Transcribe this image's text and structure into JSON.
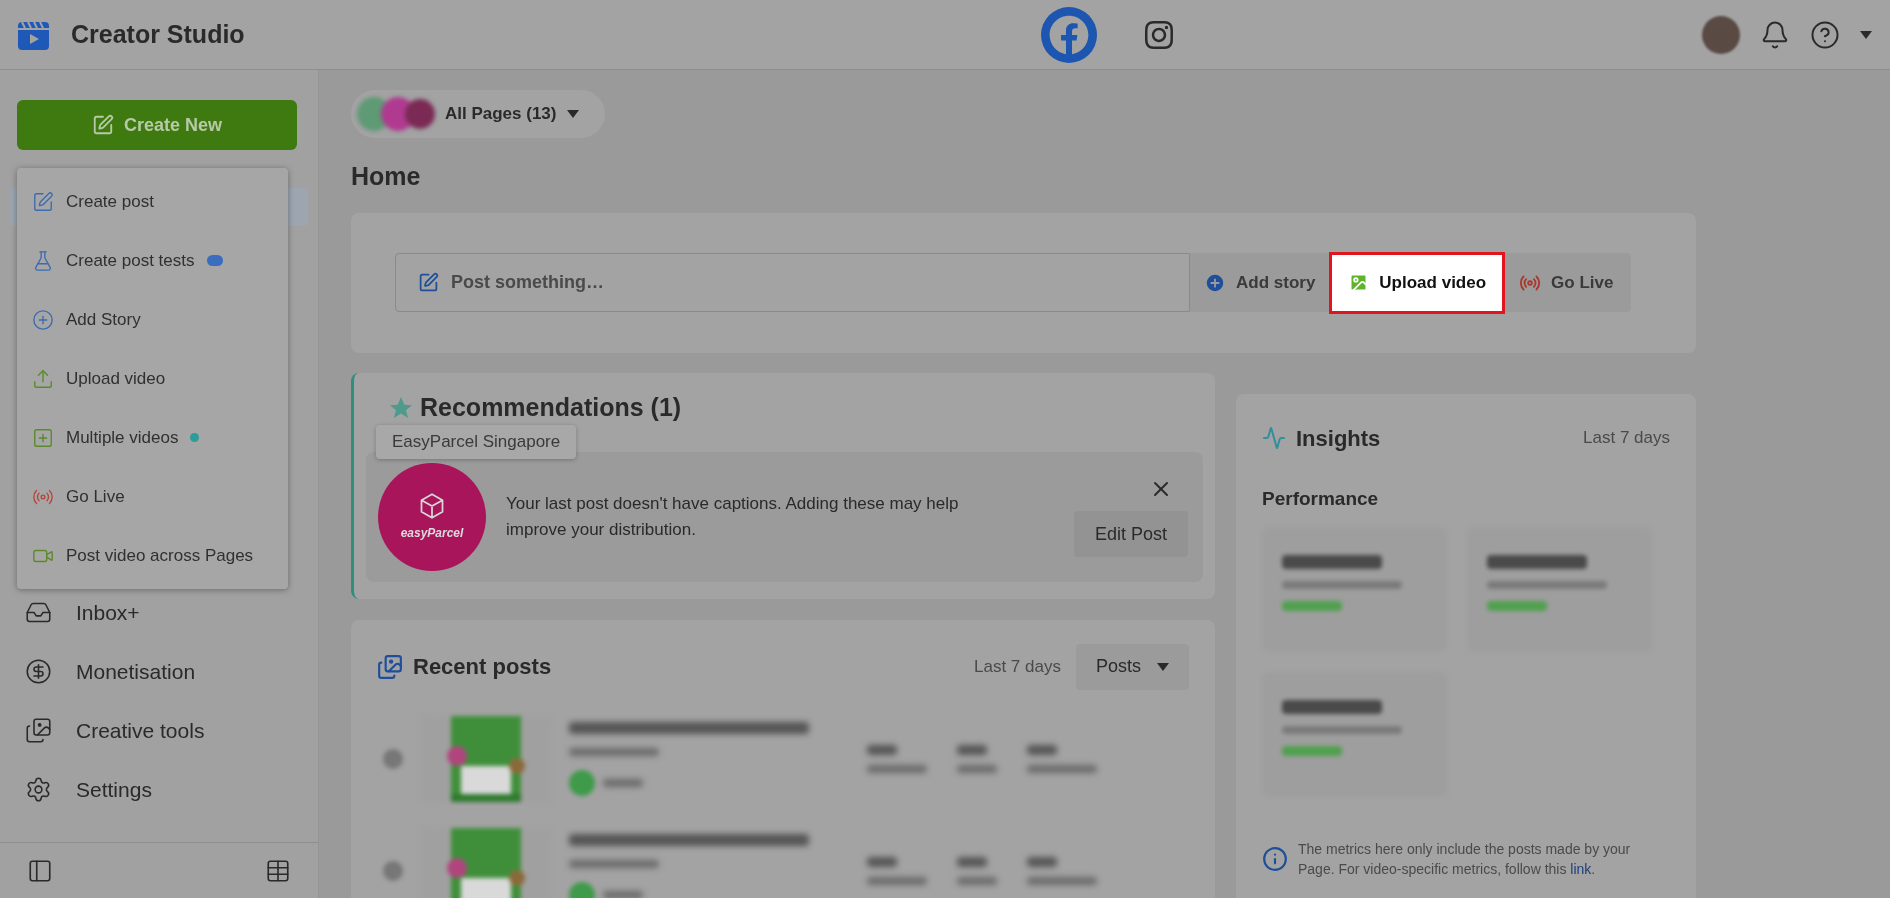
{
  "header": {
    "title": "Creator Studio",
    "platforms": [
      {
        "kind": "facebook",
        "selected": true
      },
      {
        "kind": "instagram",
        "selected": false
      }
    ]
  },
  "create_button": "Create New",
  "create_menu": [
    {
      "label": "Create post",
      "kind": "edit"
    },
    {
      "label": "Create post tests",
      "kind": "flask",
      "color": "#3a6cc0"
    },
    {
      "label": "Add Story",
      "kind": "plus"
    },
    {
      "label": "Upload video",
      "kind": "upload"
    },
    {
      "label": "Multiple videos",
      "kind": "multi",
      "color": "#2a9d9a"
    },
    {
      "label": "Go Live",
      "kind": "live"
    },
    {
      "label": "Post video across Pages",
      "kind": "cross"
    }
  ],
  "sidebar_items": [
    {
      "label": "Inbox+",
      "kind": "inbox"
    },
    {
      "label": "Monetisation",
      "kind": "money"
    },
    {
      "label": "Creative tools",
      "kind": "creative"
    },
    {
      "label": "Settings",
      "kind": "settings"
    }
  ],
  "page_selector": {
    "label": "All Pages (13)"
  },
  "heading": "Home",
  "composer": {
    "placeholder": "Post something…",
    "actions": [
      {
        "label": "Add story",
        "kind": "story",
        "highlighted": false
      },
      {
        "label": "Upload video",
        "kind": "upload",
        "highlighted": true
      },
      {
        "label": "Go Live",
        "kind": "live",
        "highlighted": false
      }
    ]
  },
  "recommendations": {
    "title": "Recommendations (1)",
    "tooltip": "EasyParcel Singapore",
    "logo_text": "easyParcel",
    "message": "Your last post doesn't have captions. Adding these may help improve your distribution.",
    "action": "Edit Post"
  },
  "recent_posts": {
    "title": "Recent posts",
    "range": "Last 7 days",
    "filter": "Posts"
  },
  "insights": {
    "title": "Insights",
    "range": "Last 7 days",
    "section": "Performance",
    "note": "The metrics here only include the posts made by your Page. For video-specific metrics, follow this ",
    "note_link": "link",
    "note_end": "."
  }
}
